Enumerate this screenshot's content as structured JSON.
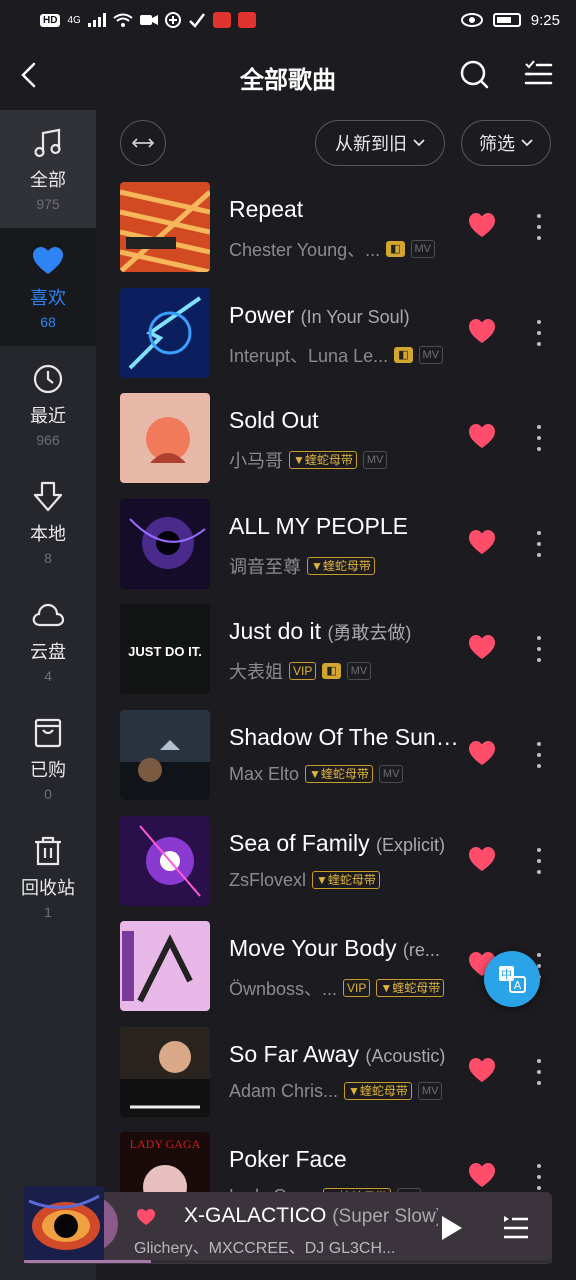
{
  "status": {
    "hd": "HD",
    "net": "4G",
    "time": "9:25"
  },
  "header": {
    "title": "全部歌曲"
  },
  "sidebar": {
    "items": [
      {
        "icon": "music-note-icon",
        "label": "全部",
        "count": "975"
      },
      {
        "icon": "heart-icon",
        "label": "喜欢",
        "count": "68"
      },
      {
        "icon": "clock-icon",
        "label": "最近",
        "count": "966"
      },
      {
        "icon": "download-icon",
        "label": "本地",
        "count": "8"
      },
      {
        "icon": "cloud-icon",
        "label": "云盘",
        "count": "4"
      },
      {
        "icon": "bag-icon",
        "label": "已购",
        "count": "0"
      },
      {
        "icon": "trash-icon",
        "label": "回收站",
        "count": "1"
      }
    ]
  },
  "toolbar": {
    "sort_label": "从新到旧",
    "filter_label": "筛选"
  },
  "songs": [
    {
      "title": "Repeat",
      "sub": "",
      "artist": "Chester Young、...",
      "badges": [
        "dolby",
        "mv"
      ]
    },
    {
      "title": "Power",
      "sub": "(In Your Soul)",
      "artist": "Interupt、Luna Le...",
      "badges": [
        "dolby",
        "mv"
      ]
    },
    {
      "title": "Sold Out",
      "sub": "",
      "artist": "小马哥",
      "badges": [
        "snake",
        "mv"
      ]
    },
    {
      "title": "ALL MY PEOPLE",
      "sub": "",
      "artist": "调音至尊",
      "badges": [
        "snake"
      ]
    },
    {
      "title": "Just do it",
      "sub": "(勇敢去做)",
      "artist": "大表姐",
      "badges": [
        "vip",
        "dolby",
        "mv"
      ]
    },
    {
      "title": "Shadow Of The Sun ...",
      "sub": "",
      "artist": "Max Elto",
      "badges": [
        "snake",
        "mv"
      ]
    },
    {
      "title": "Sea of Family",
      "sub": "(Explicit)",
      "artist": "ZsFlovexl",
      "badges": [
        "snake"
      ]
    },
    {
      "title": "Move Your Body",
      "sub": "(re...",
      "artist": "Öwnboss、...",
      "badges": [
        "vip",
        "snake"
      ]
    },
    {
      "title": "So Far Away",
      "sub": "(Acoustic)",
      "artist": "Adam Chris...",
      "badges": [
        "snake",
        "mv"
      ]
    },
    {
      "title": "Poker Face",
      "sub": "",
      "artist": "Lady Gaga",
      "badges": [
        "snake",
        "mv"
      ]
    }
  ],
  "badge_text": {
    "vip": "VIP",
    "mv": "MV",
    "snake": "▼蝰蛇母带",
    "dolby": "◧"
  },
  "player": {
    "title": "X-GALACTICO",
    "sub": "(Super Slow)",
    "artist": "Glichery、MXCCREE、DJ GL3CH...",
    "progress": 0.24
  },
  "colors": {
    "accent": "#2f84f5",
    "heart": "#ff4d6a",
    "gold": "#e0b43a"
  }
}
